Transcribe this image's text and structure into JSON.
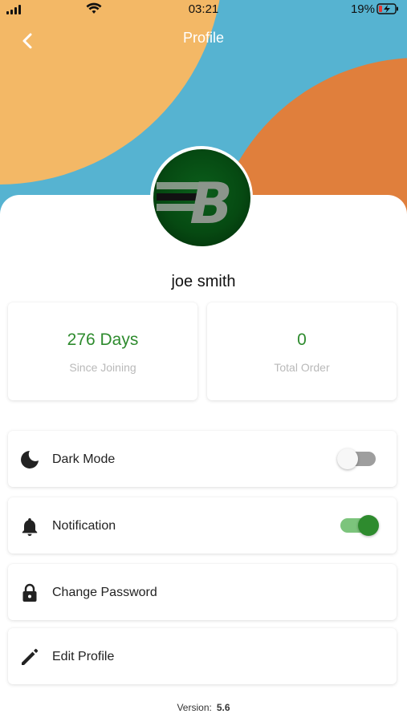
{
  "status_bar": {
    "time": "03:21",
    "battery_percent": "19%"
  },
  "header": {
    "title": "Profile",
    "back_icon": "chevron-left-icon"
  },
  "profile": {
    "name": "joe smith",
    "avatar_letter": "B"
  },
  "stats": [
    {
      "value": "276 Days",
      "label": "Since Joining"
    },
    {
      "value": "0",
      "label": "Total Order"
    }
  ],
  "settings": [
    {
      "label": "Dark Mode",
      "icon": "moon-icon",
      "toggle": "off"
    },
    {
      "label": "Notification",
      "icon": "bell-icon",
      "toggle": "on"
    },
    {
      "label": "Change Password",
      "icon": "lock-icon"
    },
    {
      "label": "Edit Profile",
      "icon": "pencil-icon"
    }
  ],
  "footer": {
    "version_label": "Version:",
    "version_value": "5.6"
  },
  "colors": {
    "accent_green": "#2e8b2e",
    "sky_blue": "#56b3d1",
    "light_orange": "#f3b866",
    "dark_orange": "#e07f3c"
  }
}
